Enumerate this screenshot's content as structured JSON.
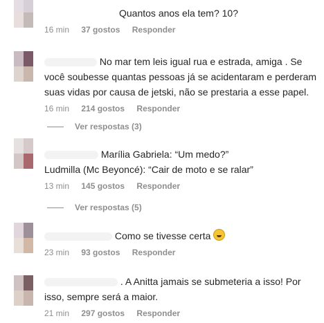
{
  "comments": [
    {
      "text": "Quantos anos ela tem? 10?",
      "time": "16 min",
      "likes": "37 gostos",
      "reply": "Responder"
    },
    {
      "text": "No mar tem leis igual rua e estrada, amiga . Se você soubesse quantas pessoas já se acidentaram e perderam suas vidas por causa de jetski, não se prestaria a esse papel.",
      "time": "16 min",
      "likes": "214 gostos",
      "reply": "Responder"
    },
    {
      "line1": "Marília Gabriela: “Um medo?”",
      "line2": "Ludmilla (Mc Beyoncé): “Cair de moto e se ralar”",
      "time": "13 min",
      "likes": "145 gostos",
      "reply": "Responder"
    },
    {
      "text": "Como se tivesse certa",
      "emoji": "grinning-sweat-emoji",
      "time": "23 min",
      "likes": "93 gostos",
      "reply": "Responder"
    },
    {
      "text": ". A Anitta jamais se submeteria a isso! Por isso, sempre será a maior.",
      "time": "21 min",
      "likes": "297 gostos",
      "reply": "Responder"
    }
  ],
  "view_replies": [
    "Ver respostas (3)",
    "Ver respostas (5)"
  ],
  "colors": {
    "text": "#262626",
    "meta": "#8e8e8e",
    "background": "#ffffff"
  }
}
